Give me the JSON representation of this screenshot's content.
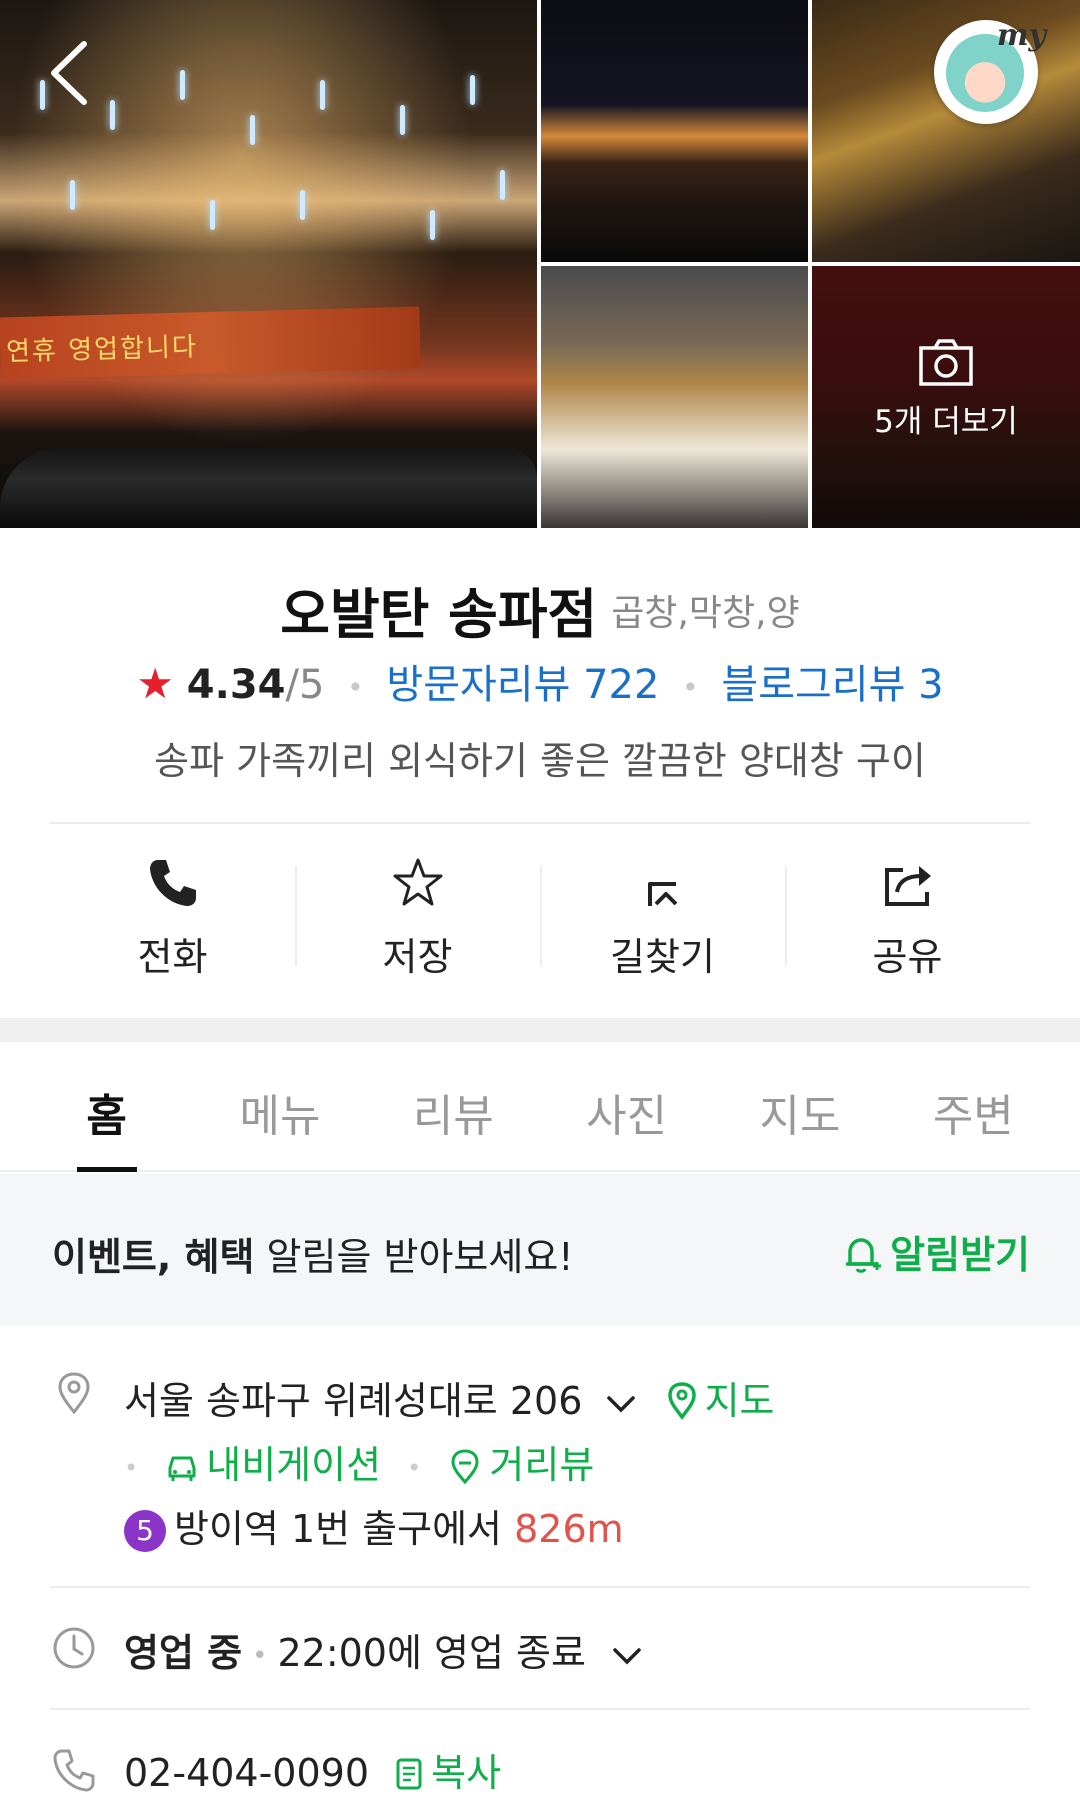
{
  "gallery": {
    "main_banner_text": "연휴 영업합니다",
    "more_photos_label": "5개 더보기",
    "my_label": "my"
  },
  "place": {
    "name": "오발탄 송파점",
    "category": "곱창,막창,양",
    "rating": "4.34",
    "rating_max": "/5",
    "visitor_reviews": "방문자리뷰 722",
    "blog_reviews": "블로그리뷰 3",
    "description": "송파 가족끼리 외식하기 좋은 깔끔한 양대창 구이"
  },
  "actions": {
    "call": "전화",
    "save": "저장",
    "directions": "길찾기",
    "share": "공유"
  },
  "tabs": [
    {
      "label": "홈",
      "active": true
    },
    {
      "label": "메뉴"
    },
    {
      "label": "리뷰"
    },
    {
      "label": "사진"
    },
    {
      "label": "지도"
    },
    {
      "label": "주변"
    }
  ],
  "notice": {
    "bold": "이벤트, 혜택",
    "text": " 알림을 받아보세요!",
    "button": "알림받기"
  },
  "info": {
    "address": "서울 송파구 위례성대로 206",
    "map_link": "지도",
    "navigation": "내비게이션",
    "street_view": "거리뷰",
    "subway_line": "5",
    "subway_station": "방이역 1번 출구에서 ",
    "subway_distance": "826m",
    "status": "영업 중",
    "hours": "22:00에 영업 종료",
    "phone": "02-404-0090",
    "copy": "복사"
  },
  "colors": {
    "accent_green": "#0fae4a",
    "link_blue": "#1a6fc9",
    "star_red": "#e5202a",
    "subway_line5": "#8a35c7",
    "distance_red": "#e2514a"
  }
}
